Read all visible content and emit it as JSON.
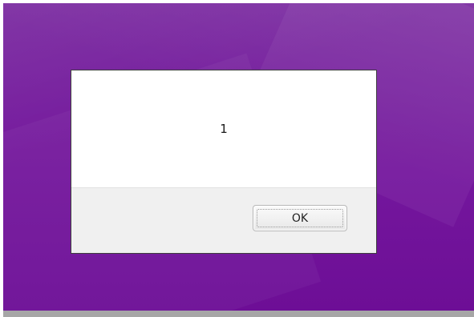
{
  "dialog": {
    "message": "1",
    "ok_label": "OK"
  },
  "colors": {
    "desktop_background": "#74179d",
    "dialog_background": "#ffffff",
    "footer_background": "#f0f0f0"
  }
}
